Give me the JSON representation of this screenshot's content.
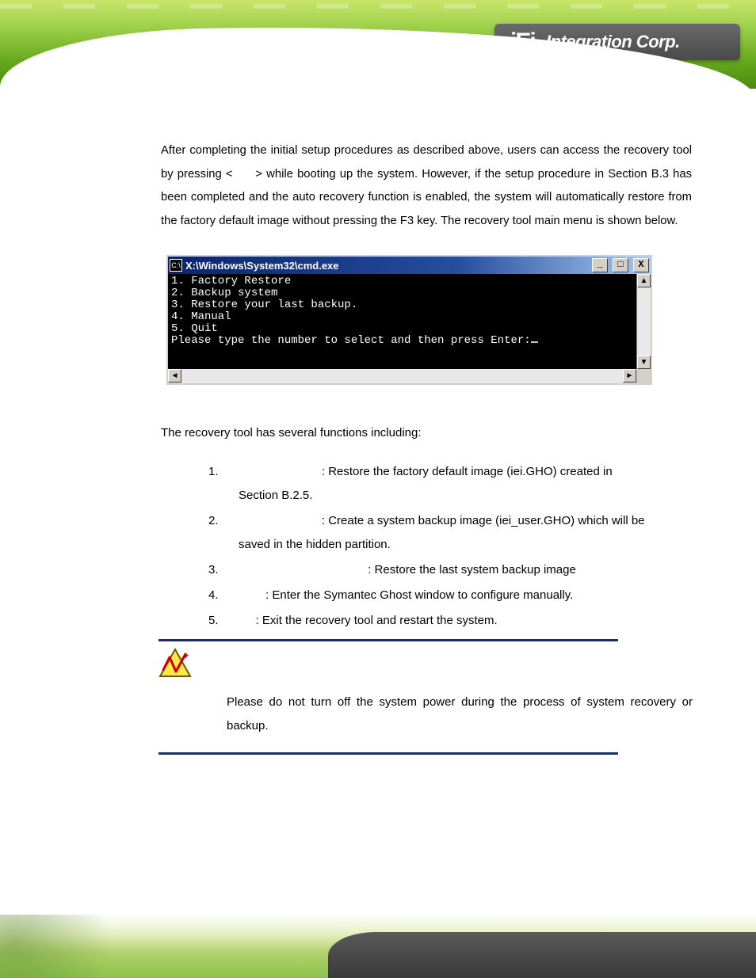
{
  "header": {
    "logo_brand": "iEi",
    "logo_suffix": "Integration Corp."
  },
  "body_paragraph": {
    "p1_a": "After completing the initial setup procedures as described above, users can access the recovery tool by pressing <",
    "p1_b": "> while booting up the system. However, if the setup procedure in Section B.3 has been completed and the auto recovery function is enabled, the system will automatically restore from the factory default image without pressing the F3 key. The recovery tool main menu is shown below."
  },
  "console": {
    "title": "X:\\Windows\\System32\\cmd.exe",
    "sysicon_text": "C:\\",
    "btn_min": "_",
    "btn_max": "□",
    "btn_close": "X",
    "menu_lines": [
      "1. Factory Restore",
      "2. Backup system",
      "3. Restore your last backup.",
      "4. Manual",
      "5. Quit"
    ],
    "prompt": "Please type the number to select and then press Enter:",
    "scroll_up": "▲",
    "scroll_down": "▼",
    "scroll_left": "◄",
    "scroll_right": "►"
  },
  "functions_intro": "The recovery tool has several functions including:",
  "functions": [
    {
      "idx": "1.",
      "text_a": ": Restore the factory default image (iei.GHO) created in",
      "cont": "Section B.2.5."
    },
    {
      "idx": "2.",
      "text_a": ": Create a system backup image (iei_user.GHO) which will be",
      "cont": "saved in the hidden partition."
    },
    {
      "idx": "3.",
      "text_a": ": Restore the last system backup image"
    },
    {
      "idx": "4.",
      "text_a": ": Enter the Symantec Ghost window to configure manually."
    },
    {
      "idx": "5.",
      "text_a": ": Exit the recovery tool and restart the system."
    }
  ],
  "functions_gaps": [
    "                             ",
    "                             ",
    "                                           ",
    "            ",
    "         "
  ],
  "warning": "Please do not turn off the system power during the process of system recovery or backup."
}
